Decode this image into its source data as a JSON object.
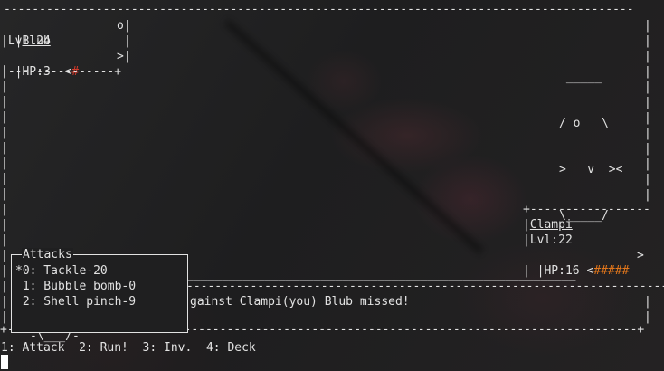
{
  "frame": {
    "top_border": "-----------------------------------------------------------------------------------------",
    "bottom_border": "+-----------------------------------------------------------------------------------------+",
    "side": "|"
  },
  "enemy": {
    "name": "Blub",
    "flag": "o",
    "level_text": "Lvl:24",
    "hp_text": "HP:3",
    "hp_bar_open": "<",
    "hp_bar_fill": "#",
    "hp_bar_close": ">",
    "hp_fraction": 0.1,
    "box_bottom": "|---------------+",
    "sprite": [
      " _____",
      "/ o   \\",
      ">   v  ><",
      "\\_____/"
    ]
  },
  "player": {
    "name": "Clampi",
    "level_text": "Lvl:22",
    "hp_text": "HP:16",
    "hp_bar_open": "<",
    "hp_bar_fill": "#####",
    "hp_bar_close": ">",
    "hp_fraction": 0.6,
    "box_top": "+-----------------",
    "sprite": [
      "  ___",
      "-/ * \\-",
      "-\\___/-"
    ]
  },
  "attacks": {
    "title": "Attacks",
    "items": [
      {
        "label": "*0: Tackle-20"
      },
      {
        "label": " 1: Bubble bomb-0"
      },
      {
        "label": " 2: Shell pinch-9"
      }
    ]
  },
  "log": {
    "message": "gainst Clampi(you) Blub missed!"
  },
  "menu": {
    "text": "1: Attack  2: Run!  3: Inv.  4: Deck"
  },
  "colors": {
    "hp_low": "#d23a2b",
    "hp_high": "#e2761b",
    "text": "#e2e2e2"
  }
}
